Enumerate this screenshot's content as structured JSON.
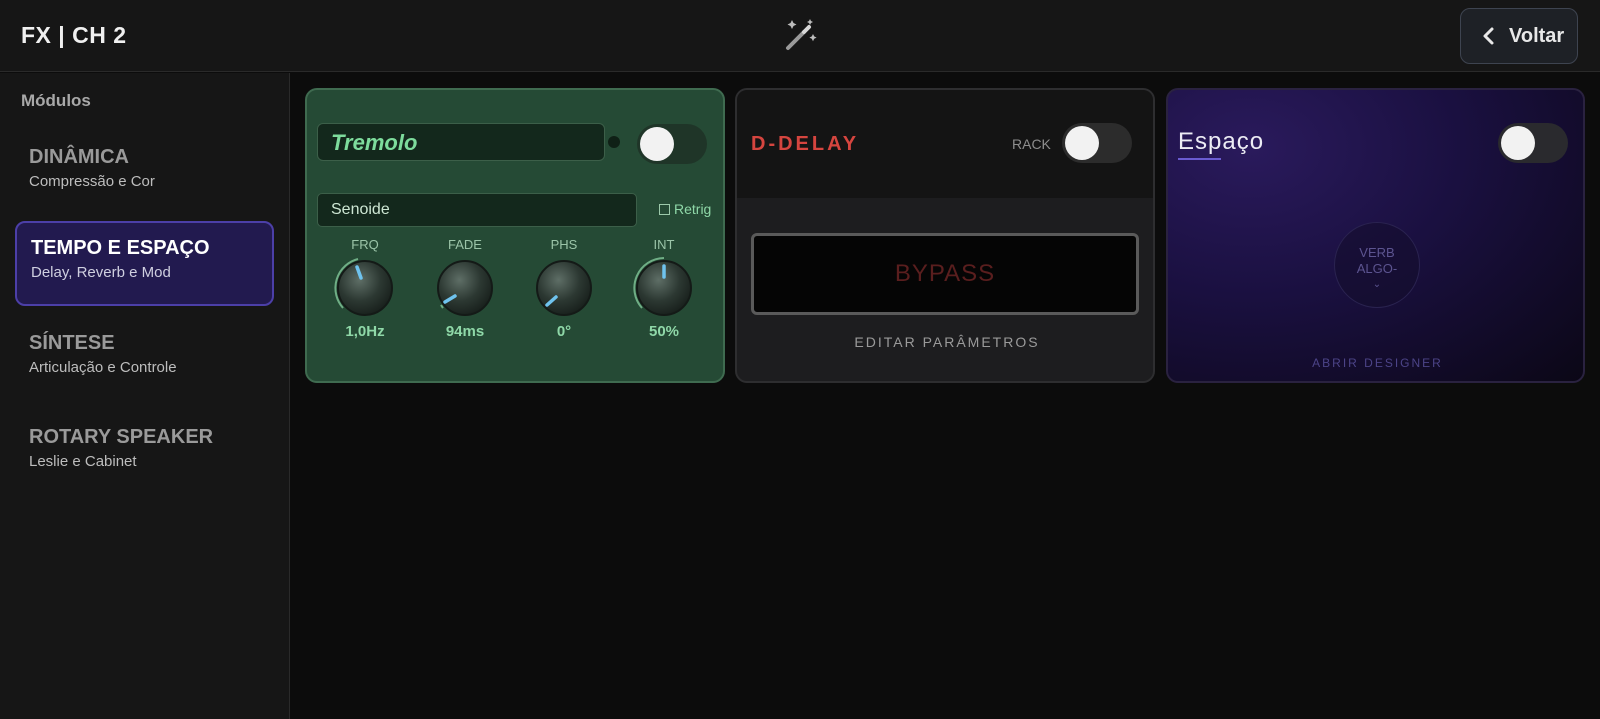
{
  "header": {
    "title": "FX | CH 2",
    "magic_icon": "magic-wand-icon",
    "back_label": "Voltar"
  },
  "sidebar": {
    "heading": "Módulos",
    "items": [
      {
        "title": "DINÂMICA",
        "subtitle": "Compressão e Cor",
        "active": false
      },
      {
        "title": "TEMPO E ESPAÇO",
        "subtitle": "Delay, Reverb e Mod",
        "active": true
      },
      {
        "title": "SÍNTESE",
        "subtitle": "Articulação e Controle",
        "active": false
      },
      {
        "title": "ROTARY SPEAKER",
        "subtitle": "Leslie e Cabinet",
        "active": false
      }
    ]
  },
  "tremolo": {
    "name": "Tremolo",
    "enabled": false,
    "waveform": "Senoide",
    "retrig_label": "Retrig",
    "retrig_checked": false,
    "knobs": [
      {
        "label": "FRQ",
        "value": "1,0Hz"
      },
      {
        "label": "FADE",
        "value": "94ms"
      },
      {
        "label": "PHS",
        "value": "0°"
      },
      {
        "label": "INT",
        "value": "50%"
      }
    ]
  },
  "delay": {
    "title": "D-DELAY",
    "rack_label": "RACK",
    "enabled": false,
    "bypass_label": "BYPASS",
    "edit_label": "EDITAR PARÂMETROS"
  },
  "espaco": {
    "title": "Espaço",
    "enabled": false,
    "algo_line1": "VERB",
    "algo_line2": "ALGO-",
    "open_designer_label": "ABRIR DESIGNER"
  },
  "colors": {
    "accent_purple": "#4c3fa8",
    "tremolo_green": "#254a35",
    "tremolo_text": "#7ddc9c",
    "delay_red": "#d5453f",
    "knob_indicator": "#6fc3ee"
  }
}
